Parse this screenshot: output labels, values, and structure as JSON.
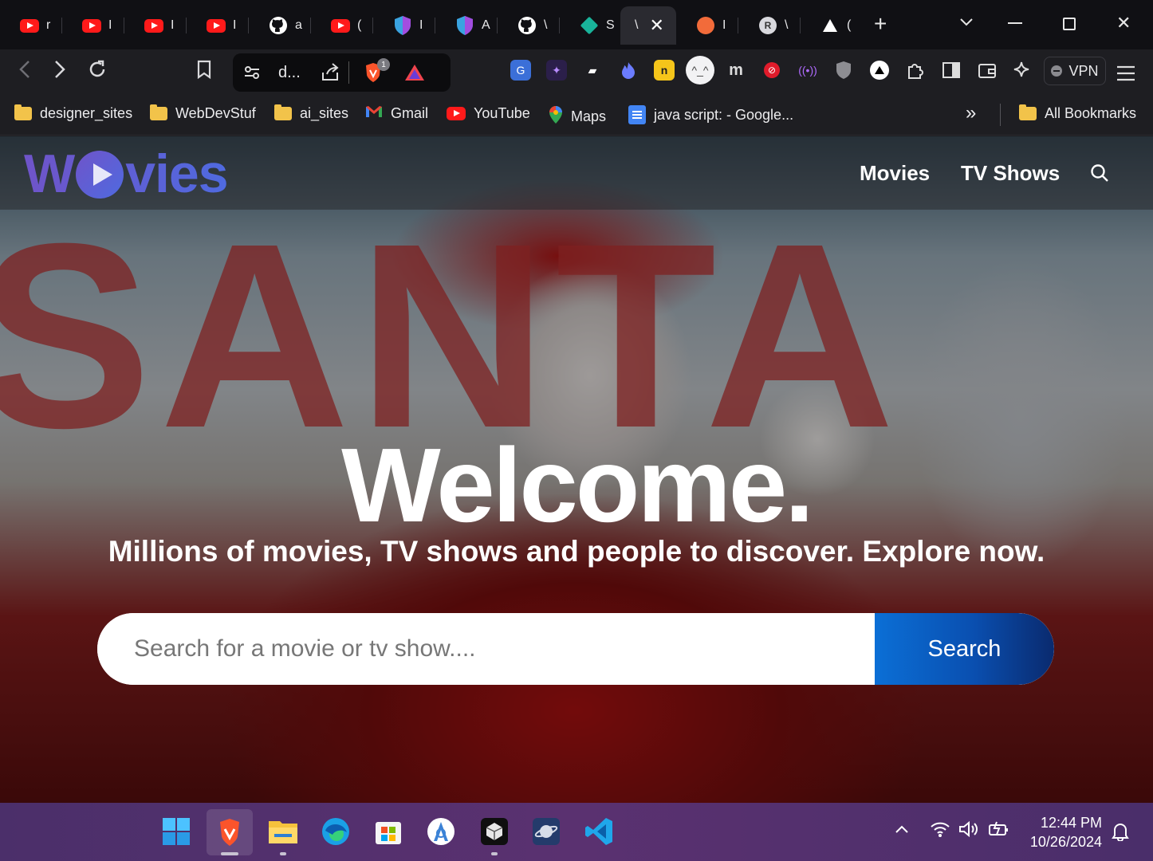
{
  "tabs": [
    {
      "icon": "youtube-icon",
      "label": "r"
    },
    {
      "icon": "youtube-icon",
      "label": "I"
    },
    {
      "icon": "youtube-icon",
      "label": "I"
    },
    {
      "icon": "youtube-icon",
      "label": "I"
    },
    {
      "icon": "github-icon",
      "label": "a"
    },
    {
      "icon": "youtube-icon",
      "label": "("
    },
    {
      "icon": "shield-icon",
      "label": "I"
    },
    {
      "icon": "shield-icon",
      "label": "A"
    },
    {
      "icon": "github-icon",
      "label": "\\"
    },
    {
      "icon": "diamond-icon",
      "label": "S"
    },
    {
      "icon": "active-tab",
      "label": "\\"
    },
    {
      "icon": "orange-icon",
      "label": "I"
    },
    {
      "icon": "r-avatar-icon",
      "label": "\\"
    },
    {
      "icon": "triangle-icon",
      "label": "("
    }
  ],
  "window": {
    "new_tab": "+",
    "tab_search": "⌄",
    "minimize": "—",
    "maximize": "☐",
    "close": "✕"
  },
  "toolbar": {
    "url": "d...",
    "brave_badge": "1",
    "vpn_label": "VPN"
  },
  "bookmarks": [
    {
      "icon": "folder-icon",
      "label": "designer_sites"
    },
    {
      "icon": "folder-icon",
      "label": "WebDevStuf"
    },
    {
      "icon": "folder-icon",
      "label": "ai_sites"
    },
    {
      "icon": "gmail-icon",
      "label": "Gmail"
    },
    {
      "icon": "youtube-icon",
      "label": "YouTube"
    },
    {
      "icon": "maps-icon",
      "label": "Maps"
    },
    {
      "icon": "docs-icon",
      "label": "java script: - Google..."
    }
  ],
  "bookmarks_more": "»",
  "all_bookmarks": "All Bookmarks",
  "site": {
    "logo_pre": "W",
    "logo_post": "vies",
    "nav": [
      "Movies",
      "TV Shows"
    ],
    "hero_letters": "SANTA",
    "welcome": "Welcome.",
    "tagline": "Millions of movies, TV shows and people to discover. Explore now.",
    "search_placeholder": "Search for a movie or tv show....",
    "search_button": "Search"
  },
  "taskbar": {
    "apps": [
      "windows-start-icon",
      "brave-browser-icon",
      "file-explorer-icon",
      "edge-icon",
      "microsoft-store-icon",
      "android-studio-icon",
      "cursor-app-icon",
      "planet-app-icon",
      "vscode-icon"
    ],
    "tray_chevron": "^",
    "time": "12:44 PM",
    "date": "10/26/2024"
  },
  "colors": {
    "accent_search": "#0a4fb0",
    "logo": "#5b5fd4",
    "taskbar": "#5a3170"
  }
}
